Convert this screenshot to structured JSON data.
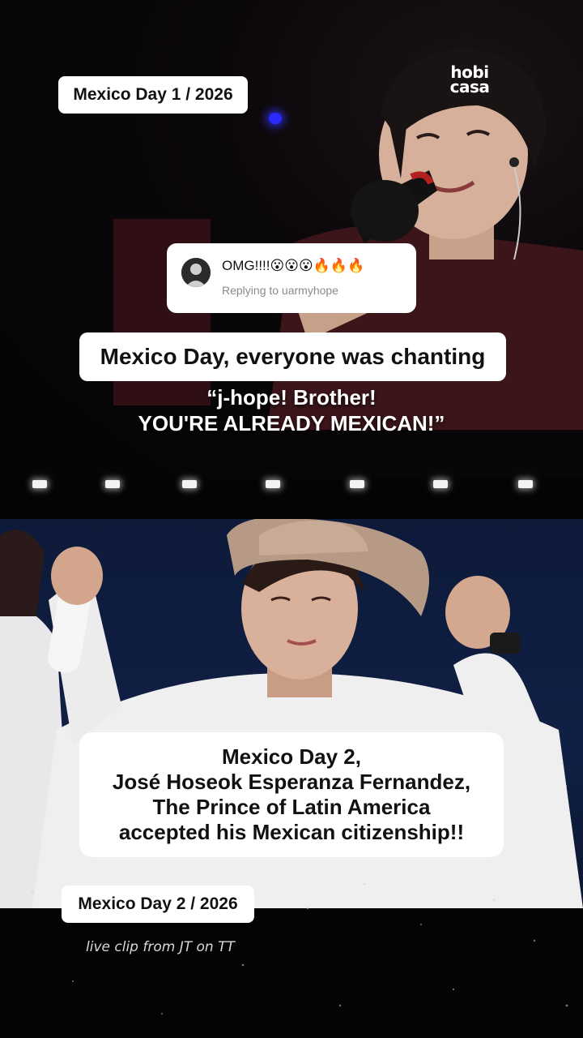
{
  "labels": {
    "top_tag": "Mexico Day 1 / 2026",
    "bottom_tag": "Mexico Day 2 / 2026"
  },
  "logo": {
    "line1": "hobi",
    "line2": "casa"
  },
  "reply_card": {
    "comment": "OMG!!!!😮😮😮🔥🔥🔥",
    "replying_to": "Replying to uarmyhope"
  },
  "banner": {
    "text": "Mexico Day, everyone was chanting"
  },
  "quote": {
    "line1": "“j-hope! Brother!",
    "line2": "YOU'RE ALREADY MEXICAN!”"
  },
  "citizenship": {
    "line1": "Mexico Day 2,",
    "line2": "José Hoseok Esperanza Fernandez,",
    "line3": "The Prince of Latin America",
    "line4": "accepted his Mexican citizenship!!"
  },
  "credit": {
    "text": "live clip from JT on TT"
  },
  "colors": {
    "background": "#000000",
    "card": "#ffffff",
    "text_dark": "#111111",
    "subtext": "#8a8a8a",
    "stage_blue": "#2a2aff",
    "jacket_white": "#eeeeee",
    "shirt_maroon": "#3a1418"
  },
  "icons": {
    "avatar": "user-avatar-icon"
  }
}
